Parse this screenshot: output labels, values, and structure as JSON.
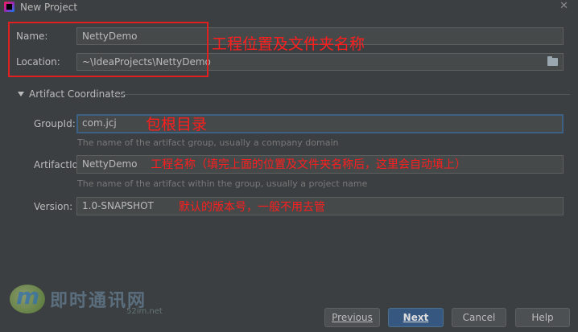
{
  "window": {
    "title": "New Project"
  },
  "form": {
    "name_label": "Name:",
    "name_value": "NettyDemo",
    "location_label": "Location:",
    "location_value": "~\\IdeaProjects\\NettyDemo",
    "section_title": "Artifact Coordinates",
    "groupid_label": "GroupId:",
    "groupid_value": "com.jcj",
    "groupid_hint": "The name of the artifact group, usually a company domain",
    "artifactid_label": "ArtifactId:",
    "artifactid_value": "NettyDemo",
    "artifactid_hint": "The name of the artifact within the group, usually a project name",
    "version_label": "Version:",
    "version_value": "1.0-SNAPSHOT"
  },
  "annotations": {
    "location": "工程位置及文件夹名称",
    "groupid": "包根目录",
    "artifactid": "工程名称（填完上面的位置及文件夹名称后，这里会自动填上）",
    "version": "默认的版本号，一般不用去管"
  },
  "buttons": {
    "previous": "Previous",
    "next": "Next",
    "cancel": "Cancel",
    "help": "Help"
  },
  "watermark": {
    "text": "即时通讯网",
    "sub": "52im.net",
    "logo_letter": "m"
  },
  "icons": {
    "app": "intellij-icon",
    "close": "close-icon",
    "folder": "folder-icon",
    "expand": "triangle-down-icon"
  },
  "colors": {
    "background": "#3c3f41",
    "field": "#45494a",
    "focus": "#3d6185",
    "annotation": "#ff1e1e",
    "primary_button": "#365880"
  }
}
